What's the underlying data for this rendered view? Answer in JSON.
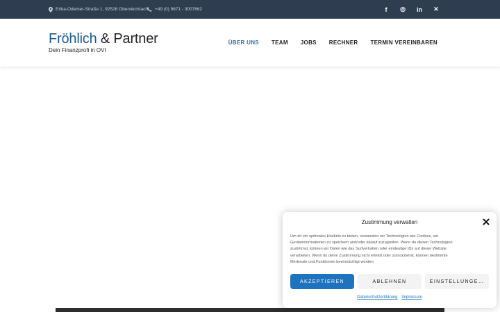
{
  "topbar": {
    "address": "Erika-Odemer-Straße 1, 92526 Oberviechtach",
    "phone": "+49 (0) 9671 - 3007662",
    "social": [
      {
        "icon": "facebook-icon",
        "glyph": "f"
      },
      {
        "icon": "instagram-icon",
        "glyph": "◎"
      },
      {
        "icon": "linkedin-icon",
        "glyph": "in"
      },
      {
        "icon": "xing-icon",
        "glyph": "✕"
      }
    ]
  },
  "header": {
    "logo_name": "Fröhlich",
    "logo_amp": "& Partner",
    "tagline": "Dein Finanzprofi in OVI"
  },
  "nav": {
    "items": [
      "ÜBER UNS",
      "TEAM",
      "JOBS",
      "RECHNER",
      "TERMIN VEREINBAREN"
    ],
    "active_index": 0
  },
  "consent": {
    "title": "Zustimmung verwalten",
    "text": "Um dir ein optimales Erlebnis zu bieten, verwenden wir Technologien wie Cookies, um Geräteinformationen zu speichern und/oder darauf zuzugreifen. Wenn du diesen Technologien zustimmst, können wir Daten wie das Surfverhalten oder eindeutige IDs auf dieser Website verarbeiten. Wenn du deine Zustimmung nicht erteilst oder zurückziehst, können bestimmte Merkmale und Funktionen beeinträchtigt werden.",
    "accept": "AKZEPTIEREN",
    "deny": "ABLEHNEN",
    "settings": "EINSTELLUNGE…",
    "link_privacy": "Datenschutzerklärung",
    "link_imprint": "Impressum"
  },
  "colors": {
    "topbar_bg": "#2e3d4f",
    "brand_blue": "#1d5c92",
    "accept_blue": "#1e73be"
  }
}
